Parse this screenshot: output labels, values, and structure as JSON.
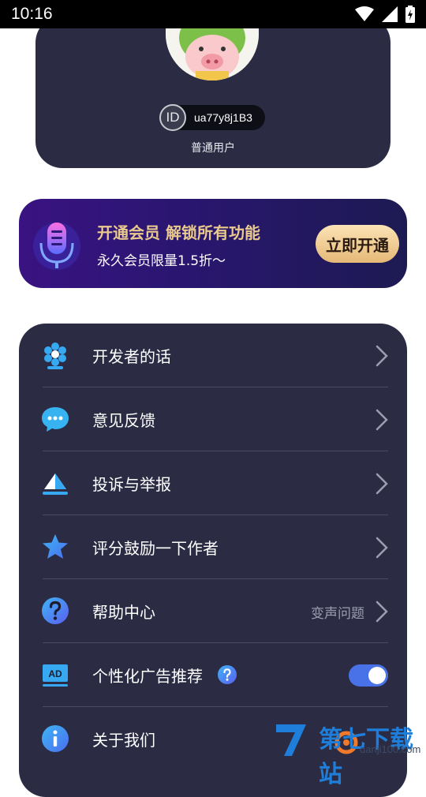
{
  "status_bar": {
    "time": "10:16",
    "icons": [
      "wifi-icon",
      "signal-icon",
      "battery-icon"
    ]
  },
  "profile": {
    "id_prefix": "ID",
    "user_id": "ua77y8j1B3",
    "level": "普通用户"
  },
  "vip": {
    "title": "开通会员 解锁所有功能",
    "subtitle": "永久会员限量1.5折～",
    "button": "立即开通"
  },
  "menu": {
    "items": [
      {
        "label": "开发者的话",
        "icon": "flower-icon"
      },
      {
        "label": "意见反馈",
        "icon": "chat-bubble-icon"
      },
      {
        "label": "投诉与举报",
        "icon": "report-icon"
      },
      {
        "label": "评分鼓励一下作者",
        "icon": "star-icon"
      },
      {
        "label": "帮助中心",
        "icon": "question-icon",
        "value": "变声问题"
      },
      {
        "label": "个性化广告推荐",
        "icon": "ad-icon",
        "toggle_on": true
      },
      {
        "label": "关于我们",
        "icon": "info-icon"
      }
    ]
  },
  "watermark": {
    "text": "第七下载站",
    "url": "danji100.com"
  },
  "colors": {
    "card_bg": "#2b2c44",
    "accent_blue": "#4a72e8",
    "gold": "#e9c98e"
  }
}
